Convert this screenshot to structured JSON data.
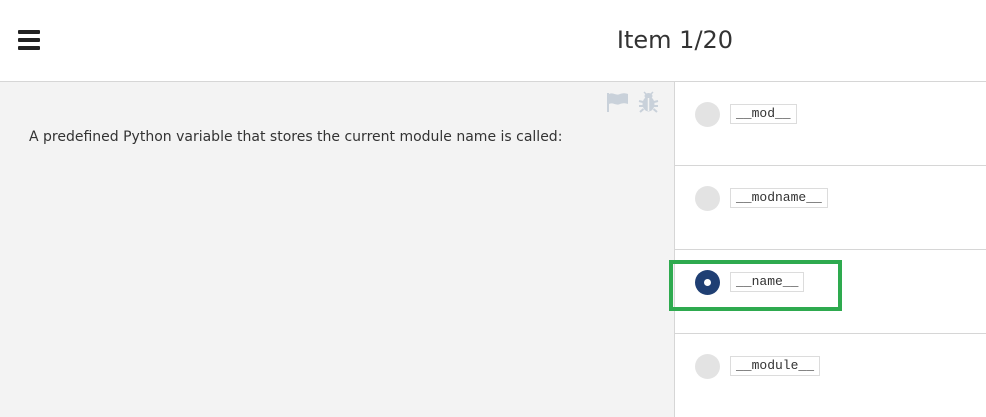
{
  "header": {
    "title": "Item 1/20",
    "menu_icon": "hamburger-menu-icon"
  },
  "question": {
    "text": "A predefined Python variable that stores the current module name is called:",
    "flag_icon": "flag-icon",
    "bug_icon": "bug-icon"
  },
  "answers": [
    {
      "label": "__mod__",
      "selected": false
    },
    {
      "label": "__modname__",
      "selected": false
    },
    {
      "label": "__name__",
      "selected": true
    },
    {
      "label": "__module__",
      "selected": false
    }
  ],
  "colors": {
    "selected_radio": "#1f3f73",
    "highlight_border": "#2eaa4f",
    "panel_bg": "#f3f3f3"
  }
}
